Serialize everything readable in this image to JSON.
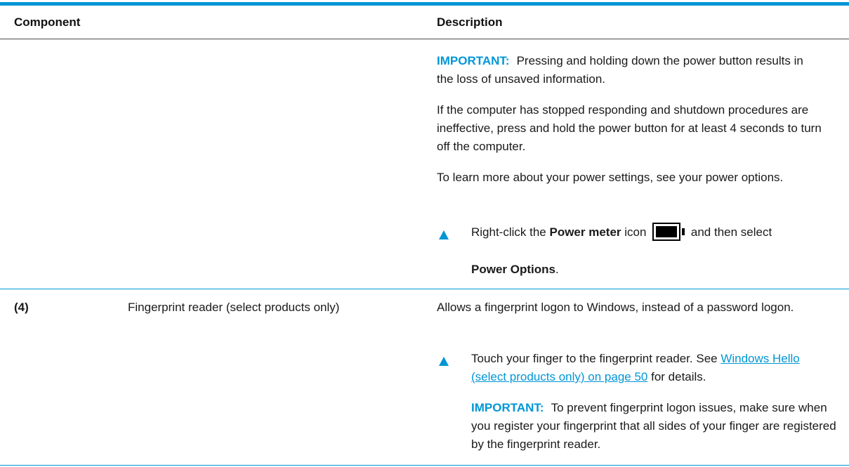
{
  "table": {
    "header": {
      "component": "Component",
      "description": "Description"
    },
    "row1": {
      "important_label": "IMPORTANT:",
      "important_text": "Pressing and holding down the power button results in the loss of unsaved information.",
      "para_stopped": "If the computer has stopped responding and shutdown procedures are ineffective, press and hold the power button for at least 4 seconds to turn off the computer.",
      "para_learn": "To learn more about your power settings, see your power options.",
      "step_prefix": "Right-click the ",
      "step_bold": "Power meter",
      "step_mid": " icon ",
      "step_suffix": " and then select",
      "step_bold2": "Power Options",
      "step_end": "."
    },
    "row2": {
      "number": "(4)",
      "component": "Fingerprint reader (select products only)",
      "description": "Allows a fingerprint logon to Windows, instead of a password logon.",
      "step_prefix": "Touch your finger to the fingerprint reader. See ",
      "step_link": "Windows Hello (select products only) on page 50",
      "step_suffix": " for details.",
      "important_label": "IMPORTANT:",
      "important_text": "To prevent fingerprint logon issues, make sure when you register your fingerprint that all sides of your finger are registered by the fingerprint reader."
    }
  },
  "colors": {
    "accent": "#0096d6",
    "text": "#1a1a1a"
  },
  "icons": {
    "bullet": "triangle-bullet-icon",
    "battery": "power-meter-icon"
  }
}
